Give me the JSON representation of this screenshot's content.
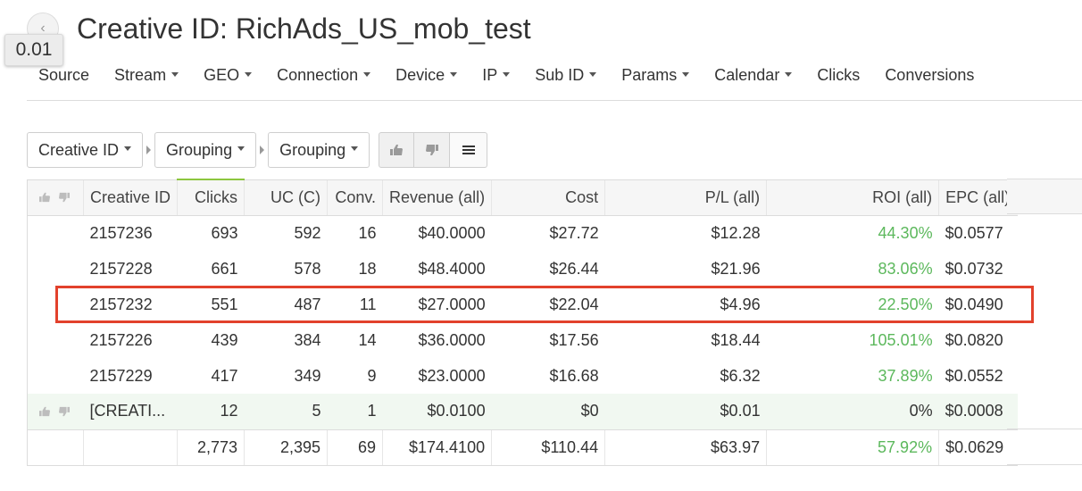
{
  "header": {
    "title": "Creative ID: RichAds_US_mob_test",
    "tooltip_value": "0.01",
    "back_icon": "chevron-left-icon"
  },
  "nav": {
    "items": [
      {
        "label": "Source",
        "dropdown": false
      },
      {
        "label": "Stream",
        "dropdown": true
      },
      {
        "label": "GEO",
        "dropdown": true
      },
      {
        "label": "Connection",
        "dropdown": true
      },
      {
        "label": "Device",
        "dropdown": true
      },
      {
        "label": "IP",
        "dropdown": true
      },
      {
        "label": "Sub ID",
        "dropdown": true
      },
      {
        "label": "Params",
        "dropdown": true
      },
      {
        "label": "Calendar",
        "dropdown": true
      },
      {
        "label": "Clicks",
        "dropdown": false
      },
      {
        "label": "Conversions",
        "dropdown": false
      }
    ]
  },
  "toolbar": {
    "group_by_1": "Creative ID",
    "group_by_2": "Grouping",
    "group_by_3": "Grouping",
    "buttons": [
      "thumbs-up-icon",
      "thumbs-down-icon",
      "menu-icon"
    ]
  },
  "table": {
    "columns": [
      "Creative ID",
      "Clicks",
      "UC (C)",
      "Conv.",
      "Revenue (all)",
      "Cost",
      "P/L (all)",
      "ROI (all)",
      "EPC (all)"
    ],
    "rows": [
      {
        "id": "2157236",
        "clicks": "693",
        "uc": "592",
        "conv": "16",
        "revenue": "$40.0000",
        "cost": "$27.72",
        "pl": "$12.28",
        "roi": "44.30%",
        "epc": "$0.0577"
      },
      {
        "id": "2157228",
        "clicks": "661",
        "uc": "578",
        "conv": "18",
        "revenue": "$48.4000",
        "cost": "$26.44",
        "pl": "$21.96",
        "roi": "83.06%",
        "epc": "$0.0732"
      },
      {
        "id": "2157232",
        "clicks": "551",
        "uc": "487",
        "conv": "11",
        "revenue": "$27.0000",
        "cost": "$22.04",
        "pl": "$4.96",
        "roi": "22.50%",
        "epc": "$0.0490"
      },
      {
        "id": "2157226",
        "clicks": "439",
        "uc": "384",
        "conv": "14",
        "revenue": "$36.0000",
        "cost": "$17.56",
        "pl": "$18.44",
        "roi": "105.01%",
        "epc": "$0.0820"
      },
      {
        "id": "2157229",
        "clicks": "417",
        "uc": "349",
        "conv": "9",
        "revenue": "$23.0000",
        "cost": "$16.68",
        "pl": "$6.32",
        "roi": "37.89%",
        "epc": "$0.0552"
      },
      {
        "id": "[CREATI...",
        "clicks": "12",
        "uc": "5",
        "conv": "1",
        "revenue": "$0.0100",
        "cost": "$0",
        "pl": "$0.01",
        "roi": "0%",
        "epc": "$0.0008"
      }
    ],
    "totals": {
      "id": "",
      "clicks": "2,773",
      "uc": "2,395",
      "conv": "69",
      "revenue": "$174.4100",
      "cost": "$110.44",
      "pl": "$63.97",
      "roi": "57.92%",
      "epc": "$0.0629"
    },
    "highlighted_row": "2157232"
  },
  "colors": {
    "positive_roi": "#5cb85c",
    "highlight_border": "#e2412c",
    "sort_indicator": "#8cc63f"
  }
}
